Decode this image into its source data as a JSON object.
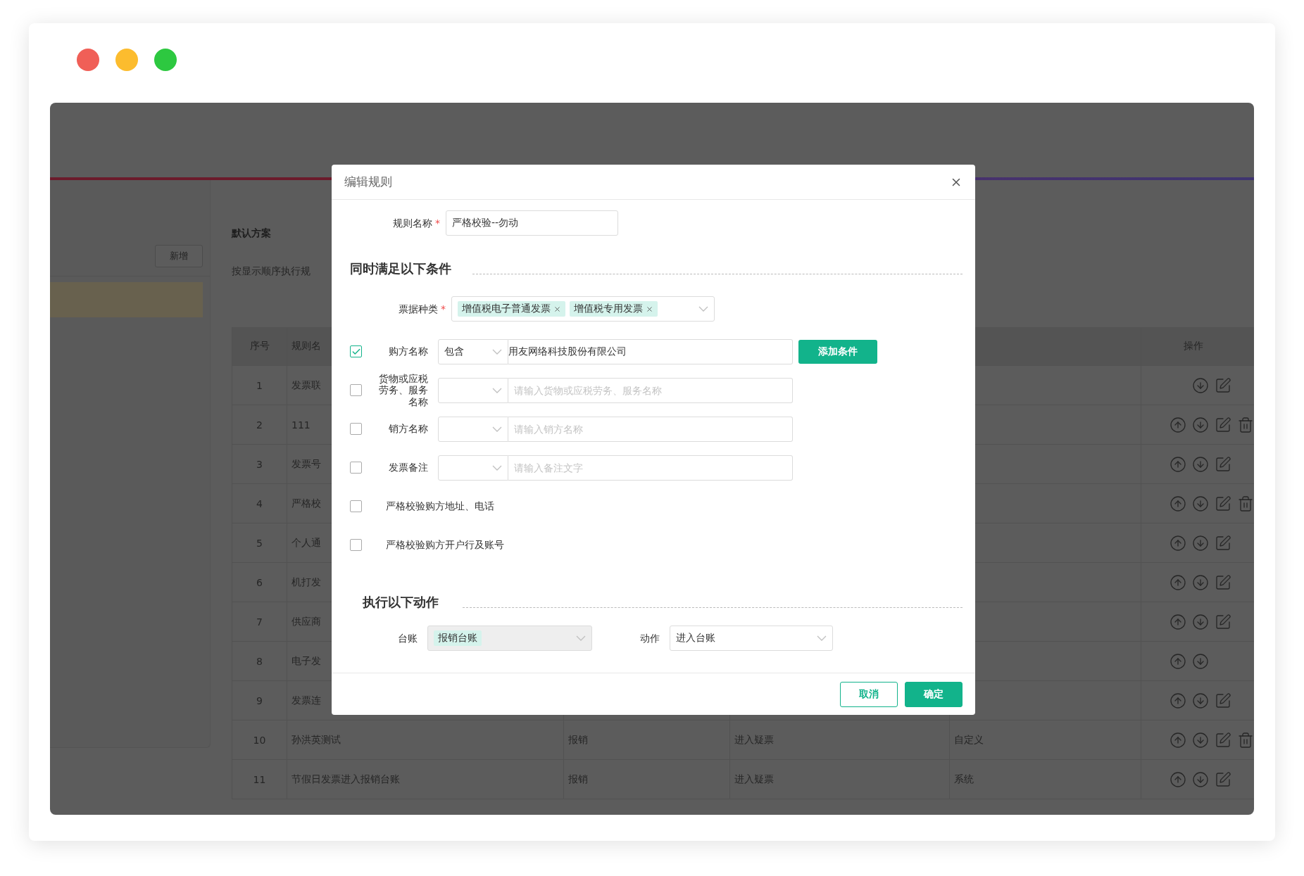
{
  "window": {
    "controls": [
      {
        "color": "#f05f57"
      },
      {
        "color": "#fcbc2e"
      },
      {
        "color": "#2dc840"
      }
    ]
  },
  "left_panel": {
    "button": "新增",
    "items": [
      {
        "selected": true
      }
    ]
  },
  "scheme": {
    "title": "默认方案",
    "hint": "按显示顺序执行规"
  },
  "table": {
    "columns": [
      "序号",
      "规则名"
    ],
    "action_column": "操作",
    "rows": [
      {
        "number": "1",
        "name": "发票联",
        "can_move_up": false,
        "can_move_down": true,
        "editable": true,
        "deletable": false
      },
      {
        "number": "2",
        "name": "111",
        "can_move_up": true,
        "can_move_down": true,
        "editable": true,
        "deletable": true
      },
      {
        "number": "3",
        "name": "发票号",
        "can_move_up": true,
        "can_move_down": true,
        "editable": true,
        "deletable": false
      },
      {
        "number": "4",
        "name": "严格校",
        "can_move_up": true,
        "can_move_down": true,
        "editable": true,
        "deletable": true
      },
      {
        "number": "5",
        "name": "个人通",
        "can_move_up": true,
        "can_move_down": true,
        "editable": true,
        "deletable": false
      },
      {
        "number": "6",
        "name": "机打发",
        "can_move_up": true,
        "can_move_down": true,
        "editable": true,
        "deletable": false
      },
      {
        "number": "7",
        "name": "供应商",
        "can_move_up": true,
        "can_move_down": true,
        "editable": true,
        "deletable": false
      },
      {
        "number": "8",
        "name": "电子发",
        "can_move_up": true,
        "can_move_down": true,
        "editable": false,
        "deletable": false
      },
      {
        "number": "9",
        "name": "发票连",
        "can_move_up": true,
        "can_move_down": true,
        "editable": true,
        "deletable": false
      },
      {
        "number": "10",
        "name": "孙洪英测试",
        "column_3": "报销",
        "column_4": "进入疑票",
        "column_5": "自定义",
        "can_move_up": true,
        "can_move_down": true,
        "editable": true,
        "deletable": true
      },
      {
        "number": "11",
        "name": "节假日发票进入报销台账",
        "column_3": "报销",
        "column_4": "进入疑票",
        "column_5": "系统",
        "can_move_up": true,
        "can_move_down": true,
        "editable": true,
        "deletable": false
      }
    ]
  },
  "modal": {
    "title": "编辑规则",
    "rule_name": {
      "label": "规则名称",
      "required_mark": "*",
      "value": "严格校验--勿动"
    },
    "conditions_title": "同时满足以下条件",
    "invoice_types": {
      "label": "票据种类",
      "required_mark": "*",
      "tags": [
        "增值税电子普通发票",
        "增值税专用发票"
      ]
    },
    "conditions": [
      {
        "kind": "match",
        "checked": true,
        "label": "购方名称",
        "operator": "包含",
        "value": "用友网络科技股份有限公司"
      },
      {
        "kind": "match",
        "checked": false,
        "label": "货物或应税劳务、服务名称",
        "placeholder": "请输入货物或应税劳务、服务名称"
      },
      {
        "kind": "match",
        "checked": false,
        "label": "销方名称",
        "placeholder": "请输入销方名称"
      },
      {
        "kind": "match",
        "checked": false,
        "label": "发票备注",
        "placeholder": "请输入备注文字"
      },
      {
        "kind": "flag",
        "checked": false,
        "label": "严格校验购方地址、电话"
      },
      {
        "kind": "flag",
        "checked": false,
        "label": "严格校验购方开户行及账号"
      }
    ],
    "add_button": "添加条件",
    "actions_title": "执行以下动作",
    "ledger": {
      "label": "台账",
      "tag": "报销台账",
      "disabled": true
    },
    "action": {
      "label": "动作",
      "value": "进入台账"
    },
    "buttons": [
      {
        "kind": "secondary",
        "label": "取消"
      },
      {
        "kind": "primary",
        "label": "确定"
      }
    ]
  }
}
